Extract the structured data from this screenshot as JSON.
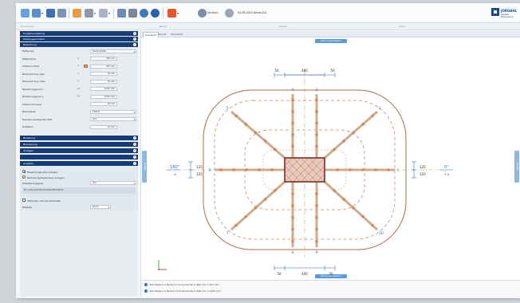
{
  "toolbar": {
    "text1": "Deutsch",
    "text2": "04.08.2023 Anhan/CA",
    "logo_name": "JORDAHL",
    "logo_sub": "Reliable Engineering"
  },
  "strip": [
    "Bauvorhaben",
    "Bauteil",
    "Position",
    "Datum"
  ],
  "left": {
    "sections": [
      {
        "label": "Projektverwaltung"
      },
      {
        "label": "Stützengeometrie"
      },
      {
        "label": "Bewehrung"
      },
      {
        "label": "Belastung"
      },
      {
        "label": "Bemessung"
      },
      {
        "label": "Vorlagen"
      },
      {
        "label": "Ausgabe"
      }
    ],
    "expanded_header": "Bewehrung",
    "props": [
      {
        "label": "Plattentyp",
        "sym": "",
        "value": "Deckenplatte",
        "select": true
      },
      {
        "label": "Plattendicke",
        "sym": "h",
        "value": "300 mm"
      },
      {
        "label": "Statische Höhe",
        "sym": "d",
        "value": "255 mm"
      },
      {
        "label": "Betondeckung oben",
        "sym": "cₒ",
        "value": "30 mm"
      },
      {
        "label": "Betondeckung unten",
        "sym": "cᵤ",
        "value": "30 mm"
      },
      {
        "label": "Bewehrungsgrad x",
        "sym": "ρx",
        "value": "0,555 mm"
      },
      {
        "label": "Bewehrungsgrad y",
        "sym": "ρy",
        "value": "0,555 mm"
      },
      {
        "label": "Stabdurchmesser",
        "sym": "",
        "value": "20 mm"
      },
      {
        "label": "Betonklasse",
        "sym": "",
        "value": "C30/37",
        "select": true
      },
      {
        "label": "Expositionsklasse EN 1992",
        "sym": "",
        "value": "XC1",
        "select": true
      },
      {
        "label": "Größtkorn",
        "sym": "",
        "value": "16 mm"
      }
    ],
    "export": {
      "opt1": "Bewehrungsnetze anzeigen",
      "opt2": "Bemessungsergebnisse anzeigen",
      "detail_label": "Detaillierungsgrad",
      "detail_value": "Voll",
      "info": "ID = J25-A70-D16-TYP-230-F88-F20-Y5",
      "checkbox_label": "Gitterplan manuell bearbeiten",
      "scale_label": "Maßstab",
      "scale_value": "Zoom"
    }
  },
  "main": {
    "tabs": [
      "Draufsicht",
      "Schnitt",
      "3D-Ansicht"
    ],
    "top_button": "Zoom zurücksetzen",
    "bottom_button": "Zoom zurücksetzen",
    "side_left": "Eingabe",
    "side_right": "Eingabe",
    "dims_top": [
      "50",
      "400",
      "50"
    ],
    "dims_bottom": [
      "50",
      "400",
      "50"
    ],
    "dims_left": [
      "125",
      "125"
    ],
    "dims_right": [
      "125",
      "125"
    ],
    "angle_left": "180°",
    "angle_left_axis": "-x",
    "angle_right": "0°",
    "angle_right_axis": "+x",
    "rail_numbers": [
      "1",
      "2",
      "3",
      "4",
      "5",
      "6",
      "7",
      "8",
      "9",
      "10"
    ],
    "legend": [
      "Bei Abstand in Bereich C ist ausreichend (600 mm > 400 mm)",
      "Bei Abstand in Bereich D ist ausreichend (600 mm > 1000 mm)"
    ]
  },
  "colors": {
    "header_blue": "#163c78",
    "accent": "#2f74c8",
    "rail_orange": "#e7a86a",
    "perimeter": "#b5644a",
    "column": "#8b3a2e"
  }
}
